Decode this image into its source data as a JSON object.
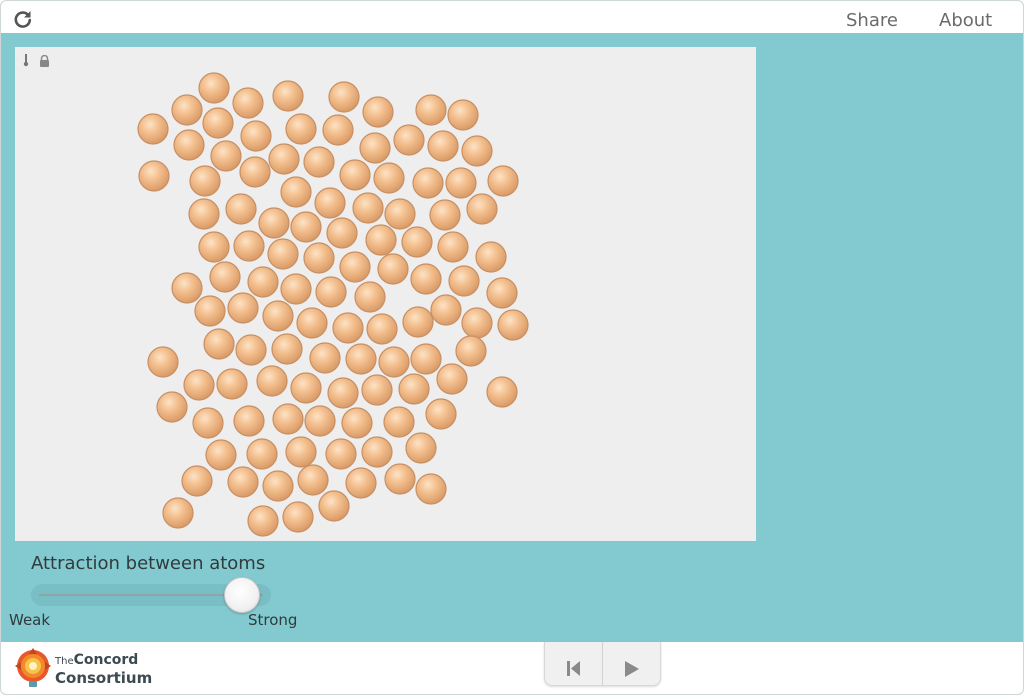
{
  "header": {
    "reload_icon": "reload-icon",
    "links": {
      "share": "Share",
      "about": "About"
    }
  },
  "model": {
    "background": "#eeeeee",
    "overlay_icons": [
      "thermometer-icon",
      "lock-icon"
    ],
    "atom_color": "#f0b98a"
  },
  "slider": {
    "label": "Attraction between atoms",
    "min_label": "Weak",
    "max_label": "Strong",
    "value_fraction": 0.89
  },
  "footer": {
    "logo_icon": "concord-consortium-logo",
    "logo_line1_prefix": "The",
    "logo_line1": "Concord",
    "logo_line2": "Consortium",
    "controls": [
      "reset-icon",
      "play-icon"
    ]
  },
  "colors": {
    "accent": "#83cad0"
  }
}
